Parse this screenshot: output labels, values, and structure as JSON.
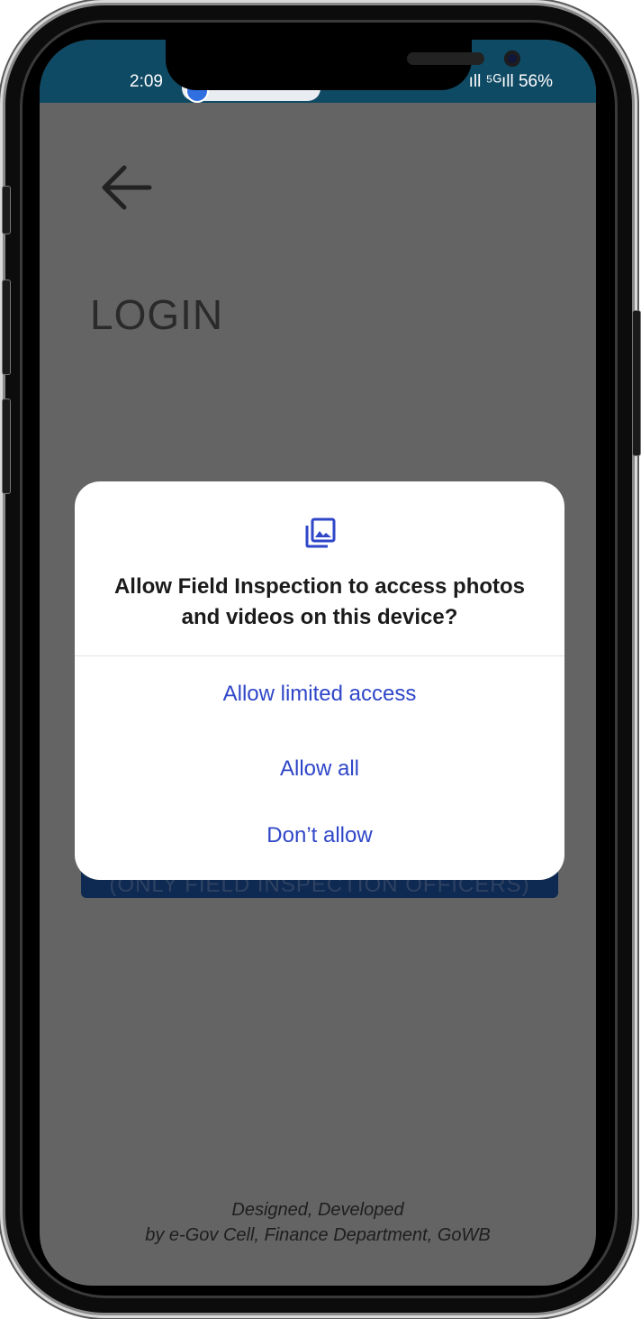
{
  "status_bar": {
    "time": "2:09",
    "right_text": "ıll ⁵ᴳıll 56%",
    "battery": "56%"
  },
  "screen": {
    "title": "LOGIN",
    "login_button_label": "(ONLY FIELD INSPECTION OFFICERS)",
    "footer_line1": "Designed, Developed",
    "footer_line2": "by e-Gov Cell, Finance Department, GoWB"
  },
  "dialog": {
    "icon": "photo-library-icon",
    "title": "Allow Field Inspection to access photos and videos on this device?",
    "options": [
      "Allow limited access",
      "Allow all",
      "Don’t allow"
    ]
  },
  "colors": {
    "status_bar": "#0f4a64",
    "scrim": "#646464",
    "accent": "#2f46c8",
    "button": "#0e2a52"
  }
}
